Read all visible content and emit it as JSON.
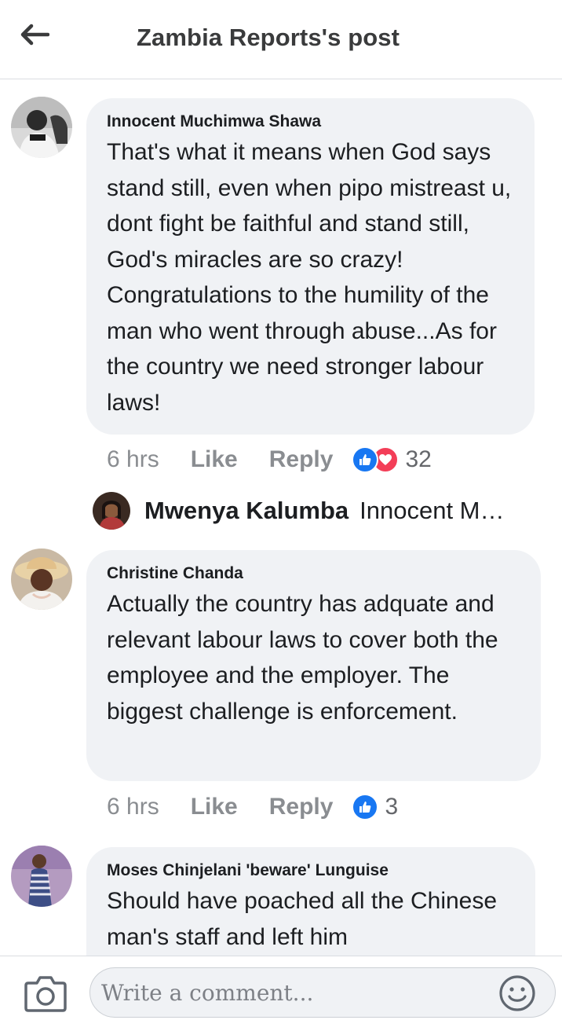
{
  "header": {
    "title": "Zambia Reports's post"
  },
  "comments": [
    {
      "author": "Innocent Muchimwa Shawa",
      "text": "That's what it means when God says stand still, even when pipo mistreast u, dont fight be faithful and stand still, God's miracles are so crazy! Congratulations to the humility of the man who went through abuse...As for the country we need stronger labour laws!",
      "time": "6 hrs",
      "like_label": "Like",
      "reply_label": "Reply",
      "reaction_icons": [
        "like-icon",
        "love-icon"
      ],
      "reaction_count": "32",
      "reply_preview": {
        "name": "Mwenya Kalumba",
        "snippet": "Innocent M…"
      }
    },
    {
      "author": "Christine Chanda",
      "text": "Actually the country has adquate and relevant labour laws to cover both the employee and the employer. The biggest challenge is enforcement.",
      "time": "6 hrs",
      "like_label": "Like",
      "reply_label": "Reply",
      "reaction_icons": [
        "like-icon"
      ],
      "reaction_count": "3"
    },
    {
      "author": "Moses Chinjelani 'beware' Lunguise",
      "text": "Should have poached all the Chinese man's staff and left him"
    }
  ],
  "composer": {
    "placeholder": "Write a comment..."
  },
  "colors": {
    "bubble": "#f0f2f5",
    "like_blue": "#1877f2",
    "love_red": "#f33e58",
    "meta_gray": "#8a8d91"
  }
}
